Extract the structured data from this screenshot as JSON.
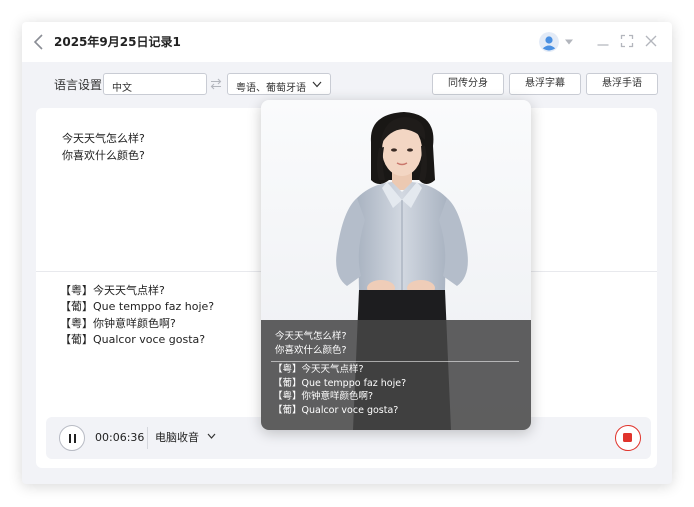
{
  "window": {
    "title": "2025年9月25日记录1"
  },
  "language": {
    "label": "语言设置",
    "source": "中文",
    "target": "粤语、葡萄牙语"
  },
  "top_buttons": [
    "同传分身",
    "悬浮字幕",
    "悬浮手语"
  ],
  "source_lines": [
    "今天天气怎么样?",
    "你喜欢什么颜色?"
  ],
  "translation_lines": [
    "【粤】今天天气点样?",
    "【葡】Que temppo faz hoje?",
    "【粤】你钟意咩颜色啊?",
    "【葡】Qualcor voce gosta?"
  ],
  "controls": {
    "timer": "00:06:36",
    "audio_source": "电脑收音"
  },
  "overlay": {
    "source_lines": [
      "今天天气怎么样?",
      "你喜欢什么颜色?"
    ],
    "translation_lines": [
      "【粤】今天天气点样?",
      "【葡】Que temppo faz hoje?",
      "【粤】你钟意咩颜色啊?",
      "【葡】Qualcor voce gosta?"
    ]
  },
  "icons": {
    "back": "chevron-left-icon",
    "user": "user-avatar-icon",
    "minimize": "minimize-icon",
    "maximize": "maximize-icon",
    "close": "close-icon",
    "swap": "swap-arrows-icon",
    "pause": "pause-icon",
    "stop": "stop-record-icon"
  },
  "colors": {
    "accent_stop": "#e0342c",
    "avatar_blue": "#4a90e2",
    "caption_bg": "#464646"
  }
}
